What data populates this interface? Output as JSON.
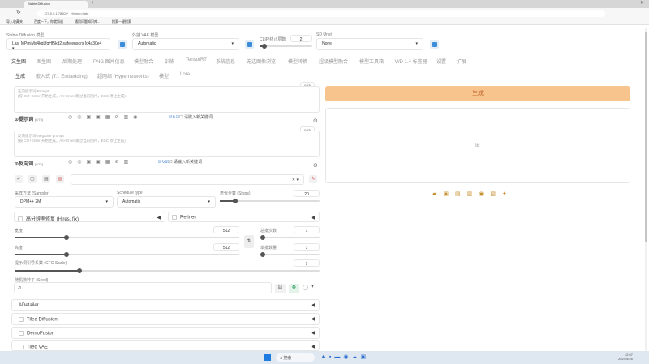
{
  "browser": {
    "tab_title": "Stable Diffusion",
    "url": "127.0.0.1:7860/?__theme=light",
    "bookmarks": [
      "导入收藏夹",
      "百度一下，你就知道",
      "通用问题知识库...",
      "搜索一键搜索"
    ]
  },
  "top": {
    "model_label": "Stable Diffusion 模型",
    "model_value": "Las_MPmiMx4kqLfgHf5kd2.safetensors [c4a30e4",
    "vae_label": "外挂 VAE 模型",
    "vae_value": "Automatic",
    "clip_label": "CLIP 终止层数",
    "clip_value": "2",
    "clip_fraction": 0.08,
    "unet_label": "SD Unet",
    "unet_value": "None"
  },
  "main_tabs": [
    "文生图",
    "图生图",
    "后期处理",
    "PNG 图片信息",
    "模型融合",
    "训练",
    "TensorRT",
    "系统信息",
    "无边图像浏览",
    "模型转换",
    "超级模型融合",
    "模型工具箱",
    "WD 1.4 标签器",
    "设置",
    "扩展"
  ],
  "sub_tabs": [
    "生成",
    "嵌入式 (T.I. Embedding)",
    "超网络 (Hypernetworks)",
    "模型",
    "Lora"
  ],
  "prompt": {
    "counter": "0/75",
    "placeholder": "正向提示词 Prompt\n(按 Ctrl+Enter 开始生成，Alt+Enter 跳过当前图片，ESC 停止生成)",
    "label": "提示词",
    "count": "(0/75)",
    "keyword_placeholder": "请键入新关键词"
  },
  "negative": {
    "counter": "0/75",
    "placeholder": "反向提示词 Negative prompt\n(按 Ctrl+Enter 开始生成，Alt+Enter 跳过当前图片，ESC 停止生成)",
    "label": "反向词",
    "count": "(0/75)",
    "keyword_placeholder": "请输入新关键词"
  },
  "settings": {
    "sampler_label": "采样方法 (Sampler)",
    "sampler_value": "DPM++ 2M",
    "schedule_label": "Schedule type",
    "schedule_value": "Automatic",
    "steps_label": "迭代步数 (Steps)",
    "steps_value": "20",
    "hires_label": "高分辨率修复 (Hires. fix)",
    "refiner_label": "Refiner",
    "width_label": "宽度",
    "width_value": "512",
    "height_label": "高度",
    "height_value": "512",
    "batch_count_label": "总批次数",
    "batch_count_value": "1",
    "batch_size_label": "单批数量",
    "batch_size_value": "1",
    "cfg_label": "提示词引导系数 (CFG Scale)",
    "cfg_value": "7",
    "seed_label": "随机数种子 (Seed)",
    "seed_value": "-1"
  },
  "accordions": [
    {
      "label": "ADetailer",
      "checkbox": false
    },
    {
      "label": "Tiled Diffusion",
      "checkbox": true
    },
    {
      "label": "DemoFusion",
      "checkbox": true
    },
    {
      "label": "Tiled VAE",
      "checkbox": true
    }
  ],
  "generate_label": "生成",
  "colors": {
    "generate": "#f7c48e",
    "accent": "#3a8dd6"
  },
  "taskbar": {
    "search": "搜索",
    "time": "12:07",
    "date": "2024/4/26"
  }
}
